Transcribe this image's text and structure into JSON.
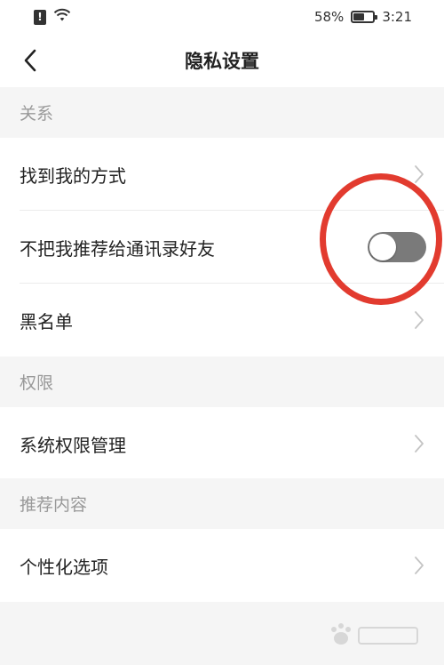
{
  "status_bar": {
    "sim_label": "!",
    "battery_percent": "58%",
    "battery_level": 0.58,
    "time": "3:21"
  },
  "header": {
    "title": "隐私设置",
    "back_icon": "chevron-left-icon"
  },
  "sections": [
    {
      "title": "关系",
      "items": [
        {
          "label": "找到我的方式",
          "control": "chevron"
        },
        {
          "label": "不把我推荐给通讯录好友",
          "control": "toggle",
          "toggle_on": false
        },
        {
          "label": "黑名单",
          "control": "chevron"
        }
      ]
    },
    {
      "title": "权限",
      "items": [
        {
          "label": "系统权限管理",
          "control": "chevron"
        }
      ]
    },
    {
      "title": "推荐内容",
      "items": [
        {
          "label": "个性化选项",
          "control": "chevron"
        }
      ]
    }
  ],
  "colors": {
    "annotation": "#e23b2f",
    "toggle_off": "#7a7a7a",
    "section_text": "#999999"
  }
}
